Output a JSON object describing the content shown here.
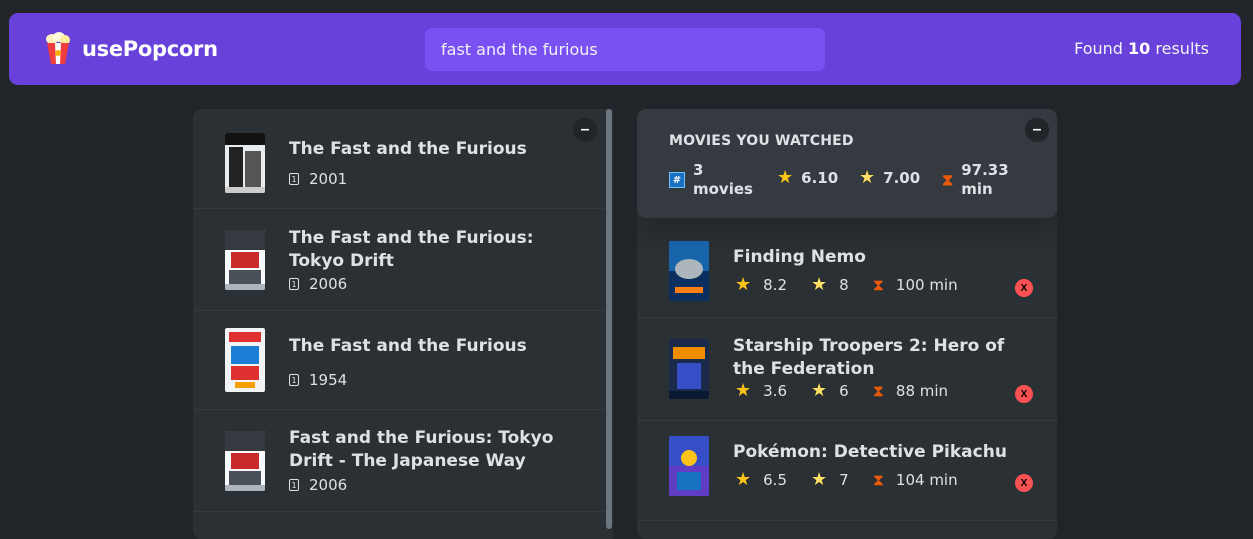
{
  "nav": {
    "logo_text": "usePopcorn",
    "search_value": "fast and the furious",
    "results_prefix": "Found",
    "results_count": "10",
    "results_suffix": "results"
  },
  "list_box": {
    "toggle_label": "–",
    "movies": [
      {
        "title": "The Fast and the Furious",
        "year": "2001"
      },
      {
        "title": "The Fast and the Furious: Tokyo Drift",
        "year": "2006"
      },
      {
        "title": "The Fast and the Furious",
        "year": "1954"
      },
      {
        "title": "Fast and the Furious: Tokyo Drift - The Japanese Way",
        "year": "2006"
      }
    ]
  },
  "watched_box": {
    "toggle_label": "–",
    "summary": {
      "title": "MOVIES YOU WATCHED",
      "count_label": "3 movies",
      "avg_imdb": "6.10",
      "avg_user": "7.00",
      "avg_runtime": "97.33 min"
    },
    "movies": [
      {
        "title": "Finding Nemo",
        "imdb": "8.2",
        "user": "8",
        "runtime": "100 min"
      },
      {
        "title": "Starship Troopers 2: Hero of the Federation",
        "imdb": "3.6",
        "user": "6",
        "runtime": "88 min"
      },
      {
        "title": "Pokémon: Detective Pikachu",
        "imdb": "6.5",
        "user": "7",
        "runtime": "104 min"
      }
    ],
    "delete_label": "X"
  },
  "icons": {
    "logo": "popcorn-icon",
    "year": "calendar-icon",
    "count": "hash-icon",
    "imdb": "star-icon",
    "user": "glowing-star-icon",
    "runtime": "hourglass-icon"
  },
  "colors": {
    "nav_bg": "#6741d9",
    "search_bg": "#7950f2",
    "page_bg": "#212529",
    "box_bg": "#2b3035",
    "delete_bg": "#fa5252"
  }
}
